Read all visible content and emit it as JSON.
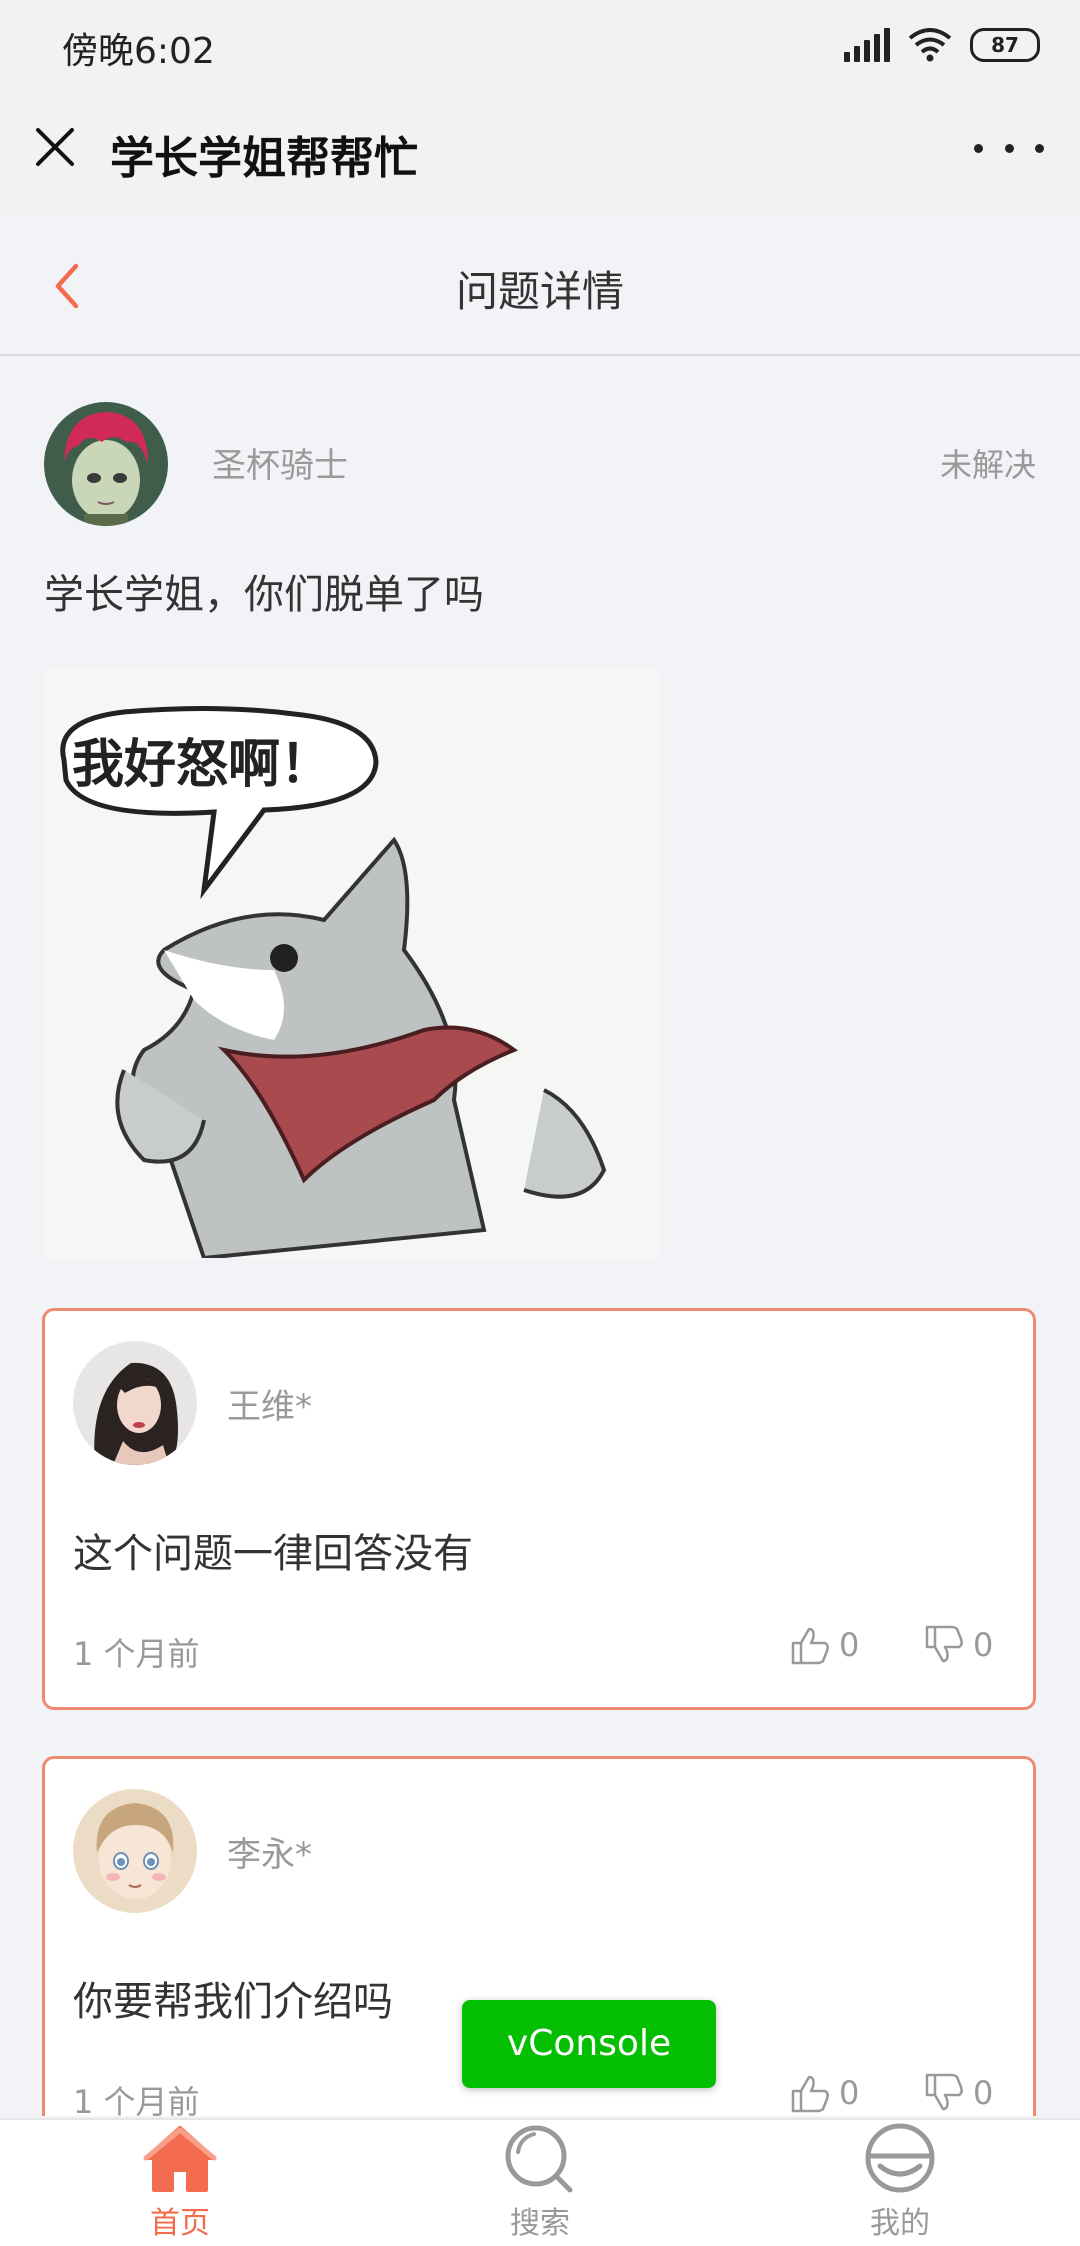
{
  "status_bar": {
    "time": "傍晚6:02",
    "battery": "87"
  },
  "mini_header": {
    "title": "学长学姐帮帮忙"
  },
  "nav": {
    "title": "问题详情"
  },
  "post": {
    "author": "圣杯骑士",
    "status": "未解决",
    "text": "学长学姐，你们脱单了吗",
    "image_caption": "我好怒啊！"
  },
  "answers": [
    {
      "name": "王维*",
      "text": "这个问题一律回答没有",
      "time": "1 个月前",
      "likes": "0",
      "dislikes": "0"
    },
    {
      "name": "李永*",
      "text": "你要帮我们介绍吗",
      "time": "1 个月前",
      "likes": "0",
      "dislikes": "0"
    }
  ],
  "vconsole": {
    "label": "vConsole"
  },
  "tabbar": {
    "items": [
      {
        "label": "首页",
        "icon": "home-icon"
      },
      {
        "label": "搜索",
        "icon": "search-icon"
      },
      {
        "label": "我的",
        "icon": "profile-icon"
      }
    ]
  },
  "colors": {
    "accent": "#f36c4f",
    "card_border": "#f08a6e",
    "vconsole": "#04be02"
  }
}
